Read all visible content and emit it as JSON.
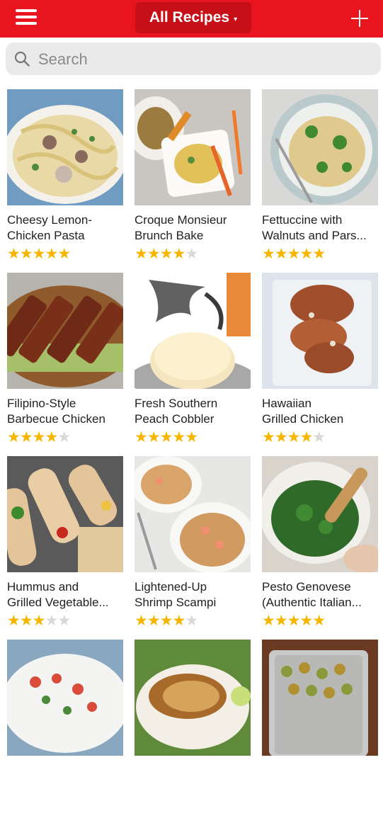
{
  "header": {
    "title": "All Recipes",
    "caret": "▾",
    "menu_icon": "hamburger-menu-icon",
    "add_icon": "plus-icon",
    "bar_color": "#e8141e",
    "title_bg_color": "#c70f18"
  },
  "search": {
    "placeholder": "Search",
    "value": ""
  },
  "recipes": [
    {
      "line1": "Cheesy Lemon-",
      "line2": "Chicken Pasta",
      "rating": 5
    },
    {
      "line1": "Croque Monsieur",
      "line2": "Brunch Bake",
      "rating": 4
    },
    {
      "line1": "Fettuccine with",
      "line2": "Walnuts and Pars...",
      "rating": 5
    },
    {
      "line1": "Filipino-Style",
      "line2": "Barbecue Chicken",
      "rating": 4
    },
    {
      "line1": "Fresh Southern",
      "line2": "Peach Cobbler",
      "rating": 5
    },
    {
      "line1": "Hawaiian",
      "line2": "Grilled Chicken",
      "rating": 4
    },
    {
      "line1": "Hummus and",
      "line2": "Grilled Vegetable...",
      "rating": 3
    },
    {
      "line1": "Lightened-Up",
      "line2": "Shrimp Scampi",
      "rating": 4
    },
    {
      "line1": "Pesto Genovese",
      "line2": "(Authentic Italian...",
      "rating": 5
    },
    {
      "line1": "",
      "line2": "",
      "rating": null
    },
    {
      "line1": "",
      "line2": "",
      "rating": null
    },
    {
      "line1": "",
      "line2": "",
      "rating": null
    }
  ],
  "star_color": "#f7b500",
  "star_empty_color": "#d8d8d8"
}
